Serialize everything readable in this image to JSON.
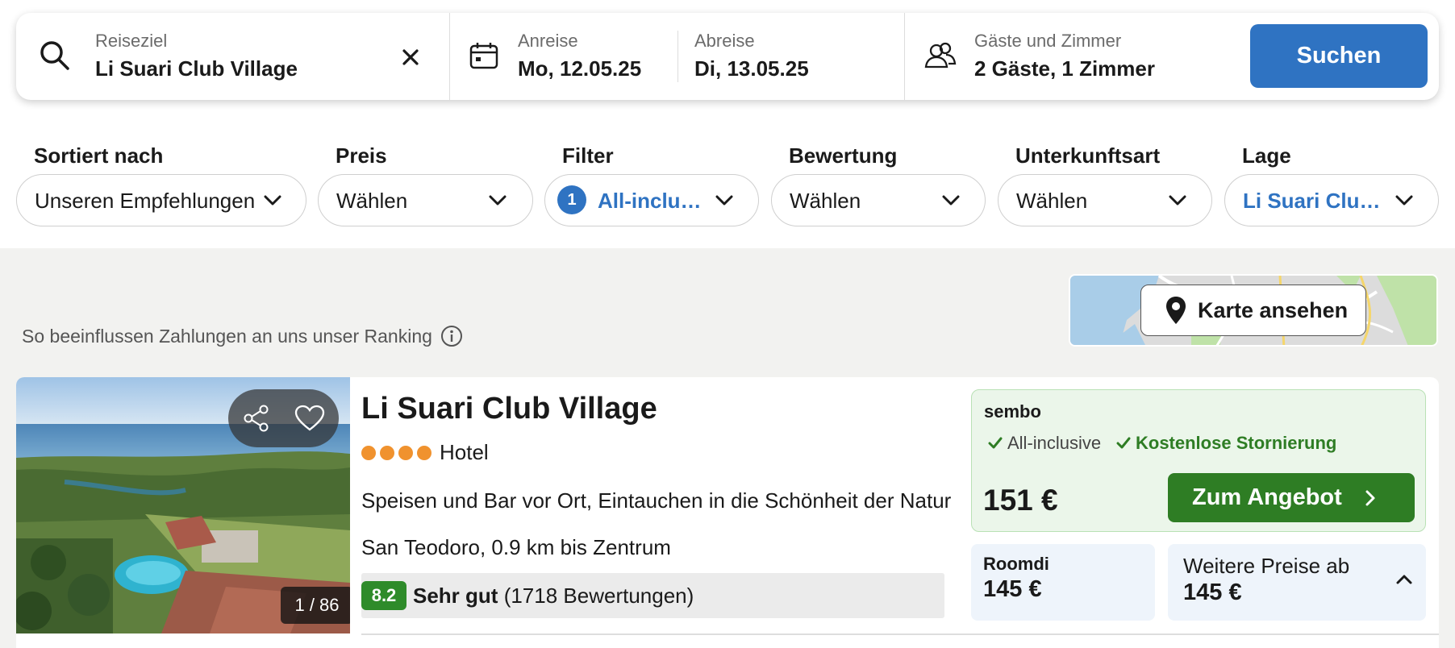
{
  "search": {
    "destination_label": "Reiseziel",
    "destination_value": "Li Suari Club Village",
    "checkin_label": "Anreise",
    "checkin_value": "Mo, 12.05.25",
    "checkout_label": "Abreise",
    "checkout_value": "Di, 13.05.25",
    "guests_label": "Gäste und Zimmer",
    "guests_value": "2 Gäste, 1 Zimmer",
    "search_button": "Suchen"
  },
  "filters": [
    {
      "label": "Sortiert nach",
      "value": "Unseren Empfehlungen"
    },
    {
      "label": "Preis",
      "value": "Wählen"
    },
    {
      "label": "Filter",
      "value": "All-inclu…",
      "count": "1"
    },
    {
      "label": "Bewertung",
      "value": "Wählen"
    },
    {
      "label": "Unterkunftsart",
      "value": "Wählen"
    },
    {
      "label": "Lage",
      "value": "Li Suari Clu…"
    }
  ],
  "ranking_text": "So beeinflussen Zahlungen an uns unser Ranking",
  "map_button": "Karte ansehen",
  "hotel": {
    "name": "Li Suari Club Village",
    "stars": 4,
    "type": "Hotel",
    "description": "Speisen und Bar vor Ort, Eintauchen in die Schönheit der Natur",
    "location": "San Teodoro, 0.9 km bis Zentrum",
    "rating_score": "8.2",
    "rating_label": "Sehr gut",
    "rating_count": "(1718 Bewertungen)",
    "photo_counter": "1 / 86",
    "deal": {
      "provider": "sembo",
      "feature_1": "All-inclusive",
      "feature_2": "Kostenlose Stornierung",
      "price": "151 €",
      "cta": "Zum Angebot"
    },
    "alt_provider": "Roomdi",
    "alt_price": "145 €",
    "more_prices_label": "Weitere Preise ab",
    "more_prices_value": "145 €"
  },
  "colors": {
    "primary_blue": "#2f73c2",
    "deal_green": "#2e7d24",
    "rating_green": "#2e8b2a",
    "star_orange": "#f0922e"
  }
}
